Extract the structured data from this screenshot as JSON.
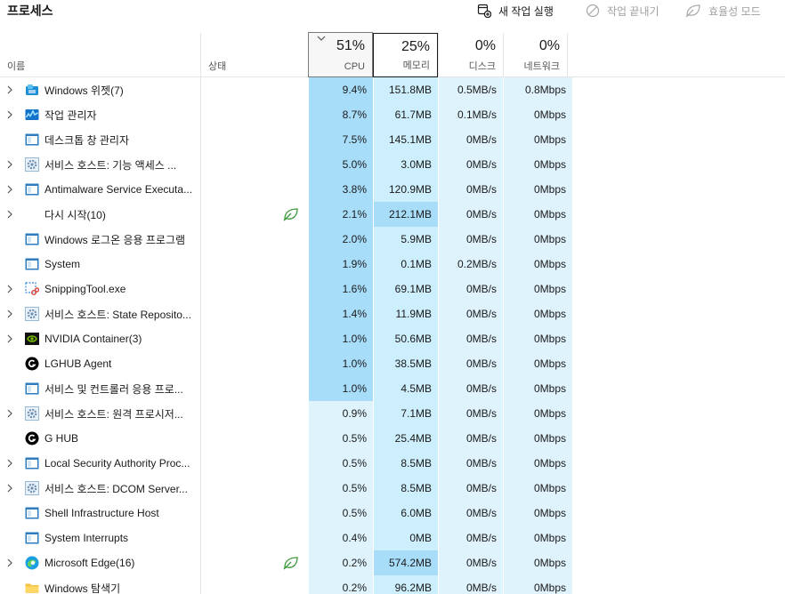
{
  "toolbar": {
    "title": "프로세스",
    "new_task_label": "새 작업 실행",
    "end_task_label": "작업 끝내기",
    "efficiency_mode_label": "효율성 모드"
  },
  "columns": {
    "name": "이름",
    "status": "상태",
    "cpu": {
      "label": "CPU",
      "pct": "51%"
    },
    "memory": {
      "label": "메모리",
      "pct": "25%"
    },
    "disk": {
      "label": "디스크",
      "pct": "0%"
    },
    "network": {
      "label": "네트워크",
      "pct": "0%"
    }
  },
  "colors": {
    "heat_low": "#dff3fd",
    "heat_mid": "#cdeefc",
    "heat_high": "#a8ddfa",
    "efficiency_leaf": "#3a9a3a"
  },
  "processes": [
    {
      "name": "Windows 위젯(7)",
      "icon": "widgets-icon",
      "expandable": true,
      "efficiency": false,
      "cpu": "9.4%",
      "memory": "151.8MB",
      "disk": "0.5MB/s",
      "network": "0.8Mbps"
    },
    {
      "name": "작업 관리자",
      "icon": "task-manager-icon",
      "expandable": true,
      "efficiency": false,
      "cpu": "8.7%",
      "memory": "61.7MB",
      "disk": "0.1MB/s",
      "network": "0Mbps"
    },
    {
      "name": "데스크톱 창 관리자",
      "icon": "window-app-icon",
      "expandable": false,
      "efficiency": false,
      "cpu": "7.5%",
      "memory": "145.1MB",
      "disk": "0MB/s",
      "network": "0Mbps"
    },
    {
      "name": "서비스 호스트: 기능 액세스 ...",
      "icon": "service-gear-icon",
      "expandable": true,
      "efficiency": false,
      "cpu": "5.0%",
      "memory": "3.0MB",
      "disk": "0MB/s",
      "network": "0Mbps"
    },
    {
      "name": "Antimalware Service Executa...",
      "icon": "window-app-icon",
      "expandable": true,
      "efficiency": false,
      "cpu": "3.8%",
      "memory": "120.9MB",
      "disk": "0MB/s",
      "network": "0Mbps"
    },
    {
      "name": "다시 시작(10)",
      "icon": "none",
      "expandable": true,
      "efficiency": true,
      "cpu": "2.1%",
      "memory": "212.1MB",
      "disk": "0MB/s",
      "network": "0Mbps"
    },
    {
      "name": "Windows 로그온 응용 프로그램",
      "icon": "window-app-icon",
      "expandable": false,
      "efficiency": false,
      "cpu": "2.0%",
      "memory": "5.9MB",
      "disk": "0MB/s",
      "network": "0Mbps"
    },
    {
      "name": "System",
      "icon": "window-app-icon",
      "expandable": false,
      "efficiency": false,
      "cpu": "1.9%",
      "memory": "0.1MB",
      "disk": "0.2MB/s",
      "network": "0Mbps"
    },
    {
      "name": "SnippingTool.exe",
      "icon": "snipping-tool-icon",
      "expandable": true,
      "efficiency": false,
      "cpu": "1.6%",
      "memory": "69.1MB",
      "disk": "0MB/s",
      "network": "0Mbps"
    },
    {
      "name": "서비스 호스트: State Reposito...",
      "icon": "service-gear-icon",
      "expandable": true,
      "efficiency": false,
      "cpu": "1.4%",
      "memory": "11.9MB",
      "disk": "0MB/s",
      "network": "0Mbps"
    },
    {
      "name": "NVIDIA Container(3)",
      "icon": "nvidia-icon",
      "expandable": true,
      "efficiency": false,
      "cpu": "1.0%",
      "memory": "50.6MB",
      "disk": "0MB/s",
      "network": "0Mbps"
    },
    {
      "name": "LGHUB Agent",
      "icon": "logitech-icon",
      "expandable": false,
      "efficiency": false,
      "cpu": "1.0%",
      "memory": "38.5MB",
      "disk": "0MB/s",
      "network": "0Mbps"
    },
    {
      "name": "서비스 및 컨트롤러 응용 프로...",
      "icon": "window-app-icon",
      "expandable": false,
      "efficiency": false,
      "cpu": "1.0%",
      "memory": "4.5MB",
      "disk": "0MB/s",
      "network": "0Mbps"
    },
    {
      "name": "서비스 호스트: 원격 프로시저...",
      "icon": "service-gear-icon",
      "expandable": true,
      "efficiency": false,
      "cpu": "0.9%",
      "memory": "7.1MB",
      "disk": "0MB/s",
      "network": "0Mbps"
    },
    {
      "name": "G HUB",
      "icon": "logitech-icon",
      "expandable": false,
      "efficiency": false,
      "cpu": "0.5%",
      "memory": "25.4MB",
      "disk": "0MB/s",
      "network": "0Mbps"
    },
    {
      "name": "Local Security Authority Proc...",
      "icon": "window-app-icon",
      "expandable": true,
      "efficiency": false,
      "cpu": "0.5%",
      "memory": "8.5MB",
      "disk": "0MB/s",
      "network": "0Mbps"
    },
    {
      "name": "서비스 호스트: DCOM Server...",
      "icon": "service-gear-icon",
      "expandable": true,
      "efficiency": false,
      "cpu": "0.5%",
      "memory": "8.5MB",
      "disk": "0MB/s",
      "network": "0Mbps"
    },
    {
      "name": "Shell Infrastructure Host",
      "icon": "window-app-icon",
      "expandable": false,
      "efficiency": false,
      "cpu": "0.5%",
      "memory": "6.0MB",
      "disk": "0MB/s",
      "network": "0Mbps"
    },
    {
      "name": "System Interrupts",
      "icon": "window-app-icon",
      "expandable": false,
      "efficiency": false,
      "cpu": "0.4%",
      "memory": "0MB",
      "disk": "0MB/s",
      "network": "0Mbps"
    },
    {
      "name": "Microsoft Edge(16)",
      "icon": "edge-icon",
      "expandable": true,
      "efficiency": true,
      "cpu": "0.2%",
      "memory": "574.2MB",
      "disk": "0MB/s",
      "network": "0Mbps"
    },
    {
      "name": "Windows 탐색기",
      "icon": "folder-icon",
      "expandable": false,
      "efficiency": false,
      "cpu": "0.2%",
      "memory": "96.2MB",
      "disk": "0MB/s",
      "network": "0Mbps"
    }
  ]
}
